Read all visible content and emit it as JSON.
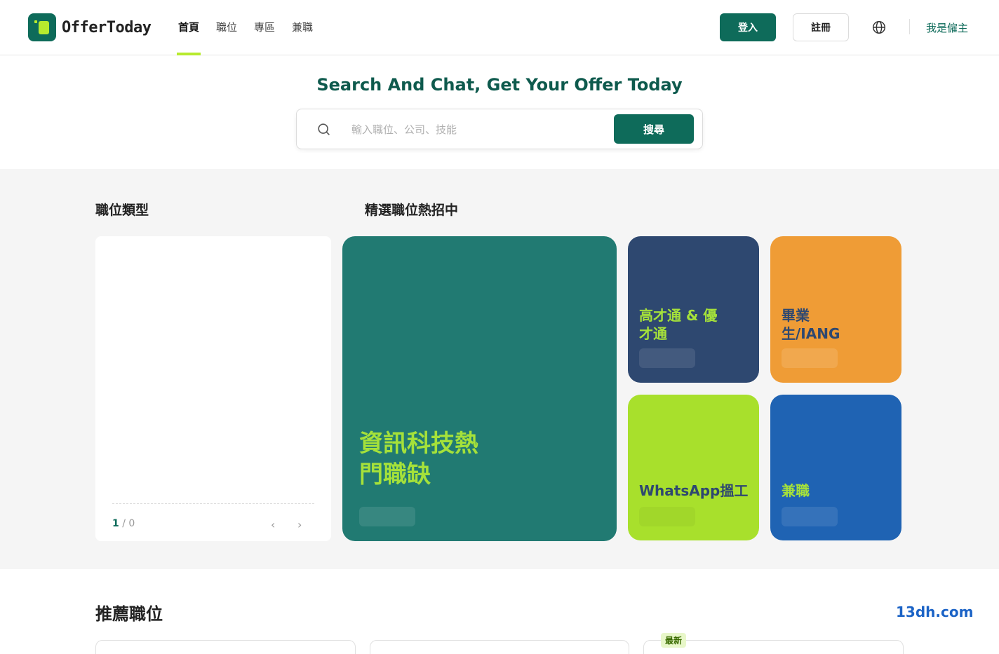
{
  "header": {
    "logo_text": "OfferToday",
    "nav": [
      {
        "label": "首頁",
        "active": true
      },
      {
        "label": "職位",
        "active": false
      },
      {
        "label": "專區",
        "active": false
      },
      {
        "label": "兼職",
        "active": false
      }
    ],
    "login_label": "登入",
    "register_label": "註冊",
    "employer_label": "我是僱主"
  },
  "hero": {
    "title": "Search And Chat, Get Your Offer Today",
    "search_placeholder": "輸入職位、公司、技能",
    "search_button": "搜尋"
  },
  "categories": {
    "title": "職位類型",
    "pager_current": "1",
    "pager_sep": " / ",
    "pager_total": "0"
  },
  "featured": {
    "title": "精選職位熱招中",
    "tiles": [
      {
        "label": "資訊科技熱門職缺",
        "bg": "#217a72",
        "fg": "#a5e13a"
      },
      {
        "label": "高才通 & 優才通",
        "bg": "#2e4870",
        "fg": "#a5e13a"
      },
      {
        "label": "畢業生/IANG",
        "bg": "#ef9c36",
        "fg": "#2e4870"
      },
      {
        "label": "WhatsApp搵工",
        "bg": "#a8e02c",
        "fg": "#2e4870"
      },
      {
        "label": "兼職",
        "bg": "#1f63b3",
        "fg": "#a5e13a"
      }
    ]
  },
  "recommended": {
    "title": "推薦職位",
    "watermark": "13dh.com",
    "badge": "最新"
  }
}
